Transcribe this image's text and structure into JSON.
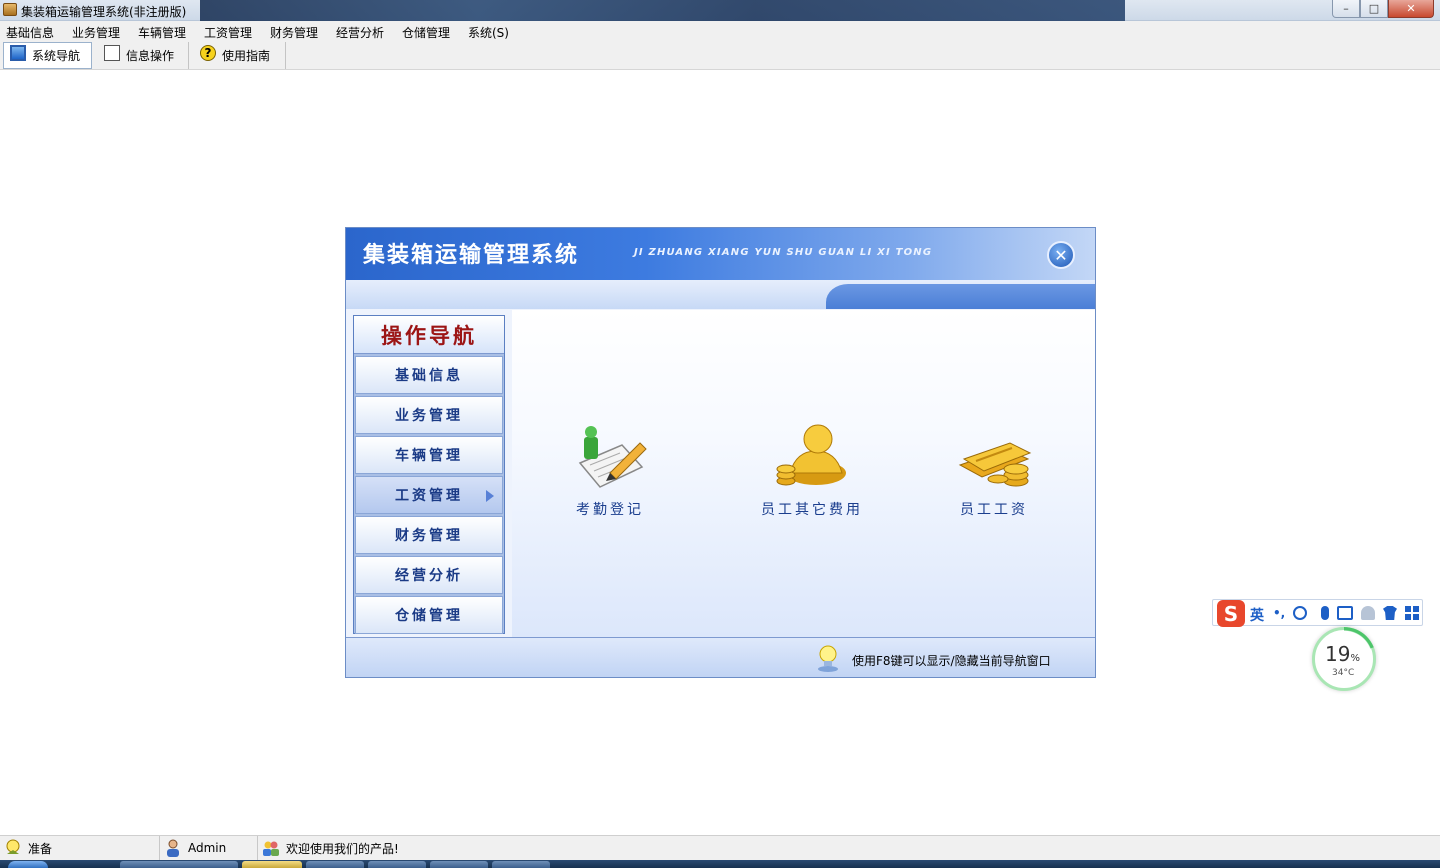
{
  "window": {
    "title": "集装箱运输管理系统(非注册版)",
    "controls": {
      "minimize": "–",
      "maximize": "□",
      "close": "✕"
    }
  },
  "menubar": {
    "items": [
      "基础信息",
      "业务管理",
      "车辆管理",
      "工资管理",
      "财务管理",
      "经营分析",
      "仓储管理",
      "系统(S)"
    ]
  },
  "toolbar": {
    "buttons": [
      {
        "label": "系统导航",
        "icon": "monitor-icon",
        "active": true
      },
      {
        "label": "信息操作",
        "icon": "grid-icon",
        "active": false
      },
      {
        "label": "使用指南",
        "icon": "help-icon",
        "active": false
      }
    ]
  },
  "nav_panel": {
    "title": "集装箱运输管理系统",
    "subtitle": "JI ZHUANG XIANG YUN SHU GUAN LI XI TONG",
    "close_label": "✕",
    "menu_title": "操作导航",
    "menu_items": [
      "基础信息",
      "业务管理",
      "车辆管理",
      "工资管理",
      "财务管理",
      "经营分析",
      "仓储管理"
    ],
    "selected_item": "工资管理",
    "features": [
      {
        "label": "考勤登记",
        "icon": "attendance-icon"
      },
      {
        "label": "员工其它费用",
        "icon": "employee-expense-icon"
      },
      {
        "label": "员工工资",
        "icon": "salary-icon"
      }
    ],
    "tip": "使用F8键可以显示/隐藏当前导航窗口"
  },
  "ime_toolbar": {
    "logo": "S",
    "language": "英",
    "punctuation": "•,"
  },
  "perf_widget": {
    "percent": "19",
    "percent_unit": "%",
    "temperature": "34°C",
    "ring_fraction": 0.19
  },
  "statusbar": {
    "ready": "准备",
    "user": "Admin",
    "welcome": "欢迎使用我们的产品!"
  },
  "colors": {
    "panel_header": "#3d7be0",
    "menu_title": "#9c1515",
    "menu_text": "#1a3a86",
    "feature_text": "#1b3e8e",
    "ime_logo": "#e8472c",
    "perf_ring": "#4dc56a"
  }
}
